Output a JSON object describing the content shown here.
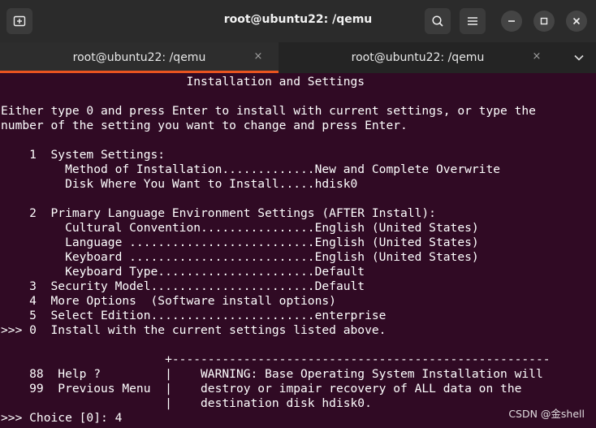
{
  "window": {
    "title": "root@ubuntu22: /qemu"
  },
  "tabs": [
    {
      "label": "root@ubuntu22: /qemu",
      "active": true
    },
    {
      "label": "root@ubuntu22: /qemu",
      "active": false
    }
  ],
  "icons": {
    "new_tab": "new-tab-icon",
    "search": "search-icon",
    "menu": "hamburger-menu-icon",
    "minimize": "minimize-icon",
    "maximize": "maximize-icon",
    "close": "close-icon",
    "tab_close": "×",
    "tab_list": "chevron-down-icon"
  },
  "colors": {
    "terminal_bg": "#300a24",
    "titlebar_bg": "#2b2b2b",
    "tab_accent": "#e95420",
    "text": "#ffffff"
  },
  "terminal": {
    "lines": [
      "                          Installation and Settings",
      "",
      "Either type 0 and press Enter to install with current settings, or type the",
      "number of the setting you want to change and press Enter.",
      "",
      "    1  System Settings:",
      "         Method of Installation.............New and Complete Overwrite",
      "         Disk Where You Want to Install.....hdisk0",
      "",
      "    2  Primary Language Environment Settings (AFTER Install):",
      "         Cultural Convention................English (United States)",
      "         Language ..........................English (United States)",
      "         Keyboard ..........................English (United States)",
      "         Keyboard Type......................Default",
      "    3  Security Model.......................Default",
      "    4  More Options  (Software install options)",
      "    5  Select Edition.......................enterprise",
      ">>> 0  Install with the current settings listed above.",
      "",
      "                       +-----------------------------------------------------",
      "    88  Help ?         |    WARNING: Base Operating System Installation will",
      "    99  Previous Menu  |    destroy or impair recovery of ALL data on the",
      "                       |    destination disk hdisk0.",
      ">>> Choice [0]: 4"
    ]
  },
  "watermark": "CSDN @金shell"
}
